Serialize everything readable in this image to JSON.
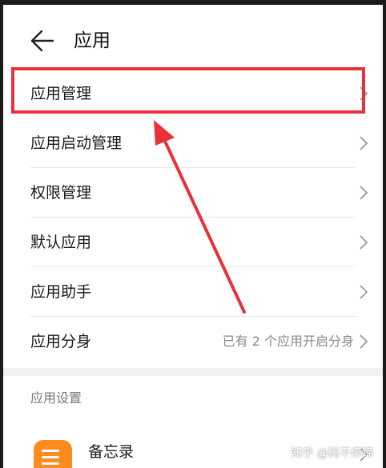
{
  "header": {
    "title": "应用",
    "back_icon": "arrow-left-icon"
  },
  "menu": [
    {
      "label": "应用管理",
      "value": ""
    },
    {
      "label": "应用启动管理",
      "value": ""
    },
    {
      "label": "权限管理",
      "value": ""
    },
    {
      "label": "默认应用",
      "value": ""
    },
    {
      "label": "应用助手",
      "value": ""
    },
    {
      "label": "应用分身",
      "value": "已有 2 个应用开启分身"
    }
  ],
  "settings": {
    "section_title": "应用设置",
    "items": [
      {
        "label": "备忘录",
        "icon": "notes-app-icon"
      }
    ]
  },
  "watermark": "知乎 @码不停蹄",
  "colors": {
    "highlight": "#e8323a",
    "memo_icon": "#ff8a1e"
  }
}
